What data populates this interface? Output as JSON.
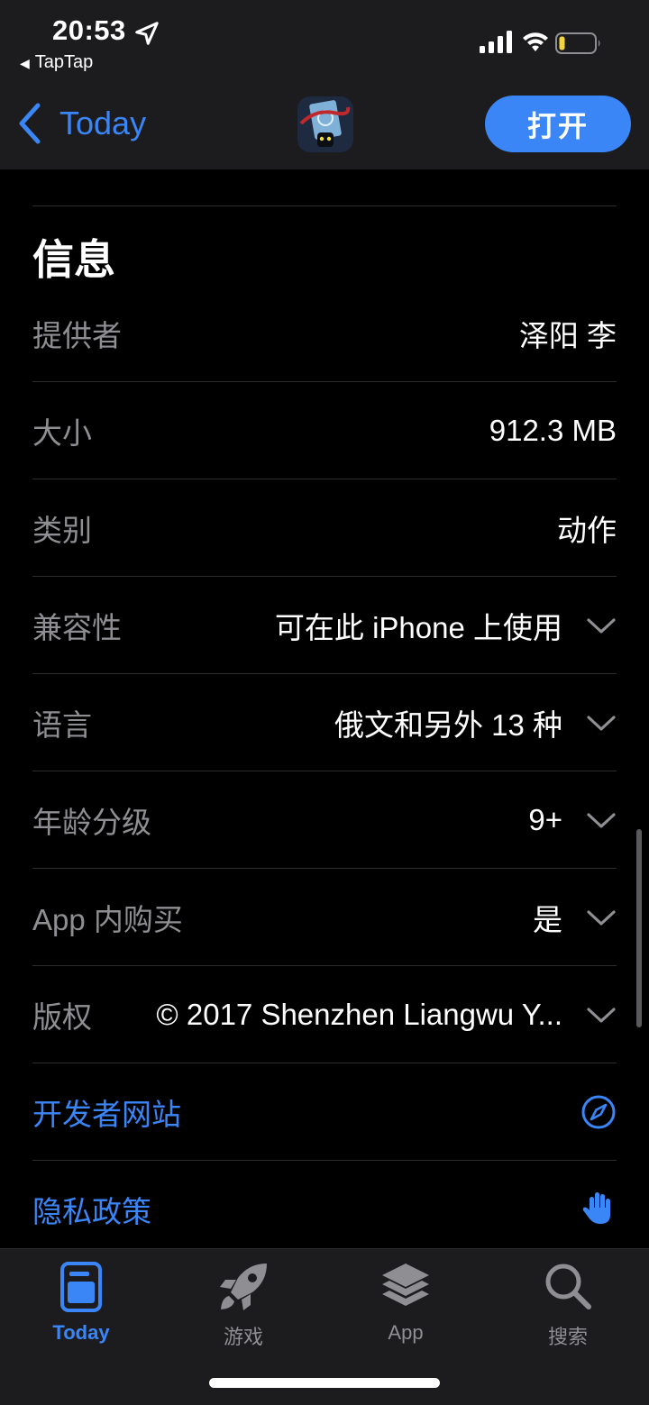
{
  "status_bar": {
    "time": "20:53",
    "back_app": "TapTap"
  },
  "nav": {
    "back_label": "Today",
    "open_button": "打开"
  },
  "section": {
    "title": "信息"
  },
  "info_rows": [
    {
      "label": "提供者",
      "value": "泽阳 李"
    },
    {
      "label": "大小",
      "value": "912.3 MB"
    },
    {
      "label": "类别",
      "value": "动作"
    },
    {
      "label": "兼容性",
      "value": "可在此 iPhone 上使用"
    },
    {
      "label": "语言",
      "value": "俄文和另外 13 种"
    },
    {
      "label": "年龄分级",
      "value": "9+"
    },
    {
      "label": "App 内购买",
      "value": "是"
    },
    {
      "label": "版权",
      "value": "© 2017 Shenzhen Liangwu Y..."
    }
  ],
  "links": {
    "developer_site": "开发者网站",
    "privacy_policy": "隐私政策"
  },
  "tabs": [
    {
      "label": "Today",
      "icon": "today-icon",
      "active": true
    },
    {
      "label": "游戏",
      "icon": "rocket-icon",
      "active": false
    },
    {
      "label": "App",
      "icon": "layers-icon",
      "active": false
    },
    {
      "label": "搜索",
      "icon": "search-icon",
      "active": false
    }
  ],
  "colors": {
    "accent": "#3b86f7",
    "background": "#000000",
    "bar_background": "#1c1c1e",
    "secondary_text": "#8e8e93",
    "battery_low": "#f4d33b"
  }
}
